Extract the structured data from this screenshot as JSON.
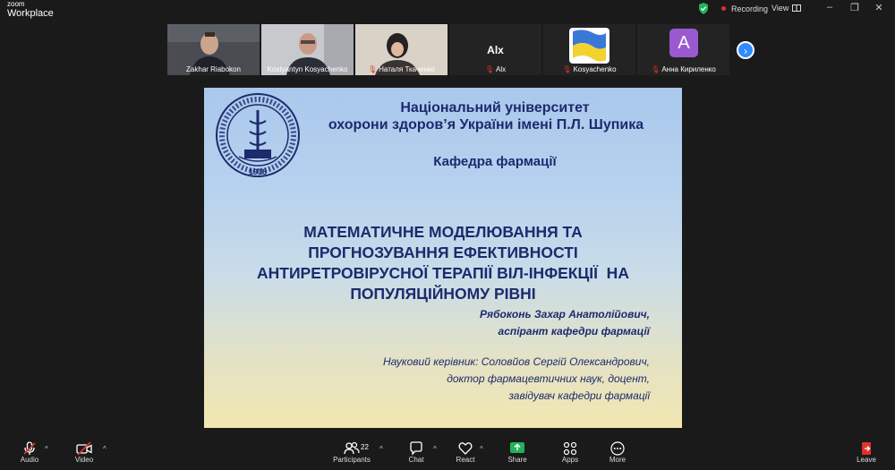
{
  "app": {
    "brand_line1": "zoom",
    "brand_line2": "Workplace"
  },
  "topbar": {
    "recording_label": "Recording",
    "view_label": "View"
  },
  "gallery": {
    "tiles": [
      {
        "name": "Zakhar Riabokon",
        "muted": false
      },
      {
        "name": "Kostyantyn Kosyachenko",
        "muted": false
      },
      {
        "name": "Наталя Ткаченко",
        "muted": true
      },
      {
        "name": "Alx",
        "muted": true,
        "display_text": "Alx"
      },
      {
        "name": "Kosyachenko",
        "muted": true
      },
      {
        "name": "Анна Кириленко",
        "muted": true,
        "avatar_letter": "A"
      }
    ]
  },
  "slide": {
    "seal_year": "1918",
    "university_line1": "Національний університет",
    "university_line2": "охорони здоров’я України імені П.Л. Шупика",
    "department": "Кафедра фармації",
    "title_lines": [
      "МАТЕМАТИЧНЕ МОДЕЛЮВАННЯ ТА",
      "ПРОГНОЗУВАННЯ ЕФЕКТИВНОСТІ",
      "АНТИРЕТРОВІРУСНОЇ ТЕРАПІЇ ВІЛ-ІНФЕКЦІЇ  НА",
      "ПОПУЛЯЦІЙНОМУ РІВНІ"
    ],
    "author_lines": [
      "Рябоконь Захар Анатолійович,",
      "аспірант кафедри фармації"
    ],
    "advisor_lines": [
      "Науковий керівник: Соловйов Сергій Олександрович,",
      "доктор фармацевтичних наук, доцент,",
      "завідувач кафедри фармації"
    ]
  },
  "toolbar": {
    "audio": "Audio",
    "video": "Video",
    "participants": "Participants",
    "participants_count": "22",
    "chat": "Chat",
    "react": "React",
    "share": "Share",
    "apps": "Apps",
    "more": "More",
    "leave": "Leave"
  },
  "colors": {
    "accent": "#2d8cff",
    "record_red": "#e0322b",
    "share_green": "#22b35a",
    "slide_text": "#1c2a6e"
  }
}
